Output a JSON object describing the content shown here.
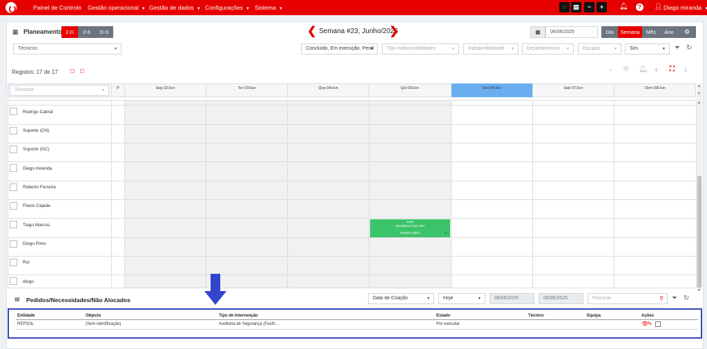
{
  "nav": {
    "items": [
      "Painel de Controlo",
      "Gestão operacional",
      "Gestão de dados",
      "Configurações",
      "Sistema"
    ],
    "user": "Diego miranda"
  },
  "header": {
    "title": "Planeamento",
    "view_buttons": [
      "2-D",
      "2-6",
      "D-S"
    ],
    "week_title": "Semana #23, Junho/2025",
    "date_value": "06/06/2025",
    "period_buttons": [
      "Dia",
      "Semana",
      "Mês",
      "Ano"
    ]
  },
  "filters": {
    "tecnicos": "Técnicos",
    "estado": "Concluído, Em execução, Pend",
    "tipo_indisp": "Tipo Indisponibilidades",
    "indisp": "Indisponibilidade",
    "departamentos": "Departamentos",
    "equipas": "Equipas",
    "sim": "Sim"
  },
  "registos": "Registos: 17 de 17",
  "grid": {
    "tech_filter_placeholder": "Técnicos",
    "p_col": "P",
    "days": [
      "Seg 02/Jun",
      "Ter 03/Jun",
      "Qua 04/Jun",
      "Qui 05/Jun",
      "Sex 06/Jun",
      "Sab 07/Jun",
      "Dom 08/Jun"
    ],
    "rows": [
      "Rodrigo Cabral",
      "Suporte (CN)",
      "Suporte (GC)",
      "Diego miranda",
      "Roberto Ferreira",
      "Flavio Cajada",
      "Tiago Marcos",
      "Diogo Pinto",
      "Rui",
      "diogo"
    ],
    "event": {
      "line1": "teste",
      "line2": "XEvolution Fast User",
      "line3": "Registo Diário"
    }
  },
  "pedidos": {
    "title": "Pedidos/Necessidades/Não Alocados",
    "sort_by": "Data de Criação",
    "period": "Hoje",
    "date_from": "06/06/2025",
    "date_to": "06/06/2025",
    "search_placeholder": "Procurar",
    "columns": [
      "Entidade",
      "Objecto",
      "Tipo de Intervenção",
      "Estado",
      "Técnico",
      "Equipa",
      "Ações"
    ],
    "rows": [
      [
        "REPSOL",
        "(Sem identificação)",
        "Auditoria de Segurança (Fastfi...",
        "Por executar",
        "",
        ""
      ]
    ]
  },
  "colors": {
    "brand": "#e60000",
    "highlight_day": "#6aaef0",
    "event": "#3cc46a",
    "annotation": "#3344bb"
  }
}
